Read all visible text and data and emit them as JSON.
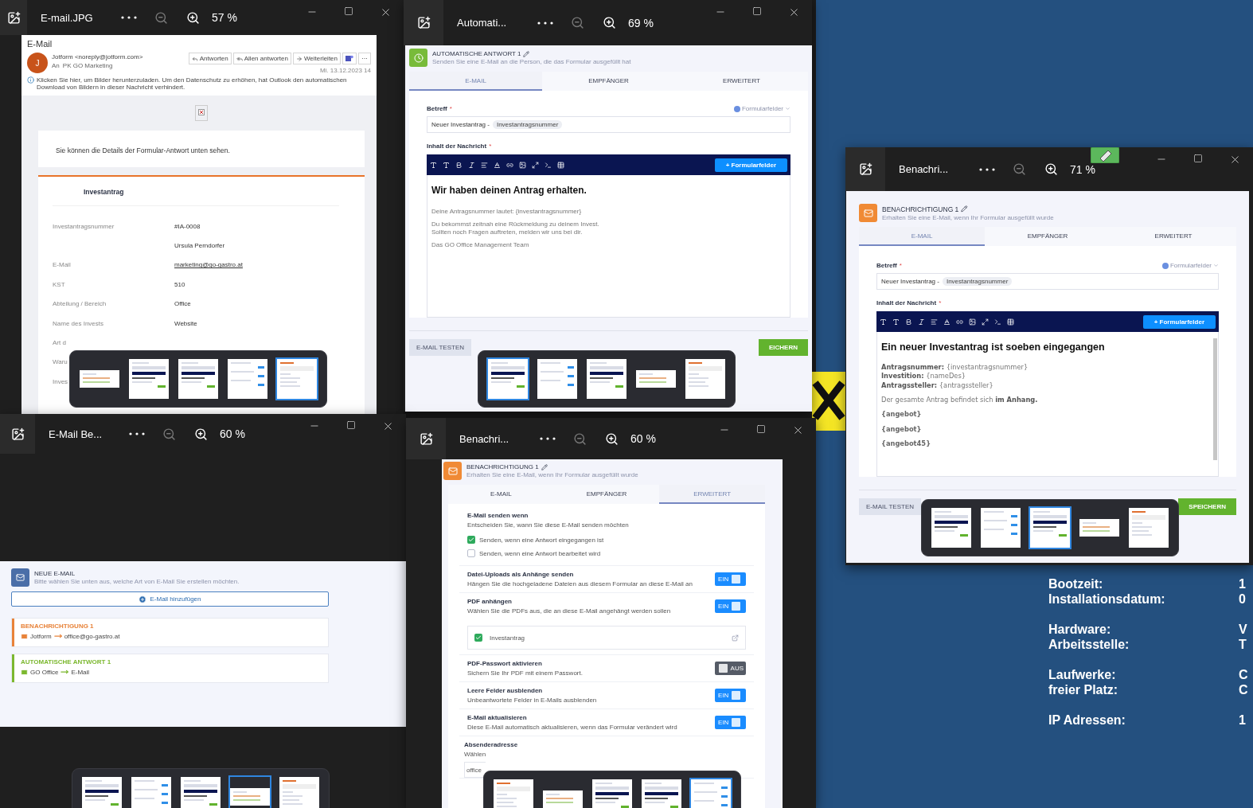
{
  "windows": [
    {
      "kind": "email",
      "title": "E-mail.JPG",
      "zoom": "57 %",
      "thumbnails": [
        {
          "kind": "list",
          "selected": false
        },
        {
          "kind": "editor",
          "selected": false
        },
        {
          "kind": "editor",
          "selected": false
        },
        {
          "kind": "settings",
          "selected": false
        },
        {
          "kind": "email",
          "selected": true
        }
      ],
      "page": {
        "heading": "E-Mail",
        "initial": "J",
        "sender": "Jotform <noreply@jotform.com>",
        "to_label": "An",
        "to": "PK GO Marketing",
        "actions": [
          "Antworten",
          "Allen antworten",
          "Weiterleiten"
        ],
        "more": "···",
        "date": "Mi. 13.12.2023 14",
        "notice": "Klicken Sie hier, um Bilder herunterzuladen. Um den Datenschutz zu erhöhen, hat Outlook den automatischen Download von Bildern in dieser Nachricht verhindert.",
        "intro": "Sie können die Details der Formular-Antwort unten sehen.",
        "form_title": "Investantrag",
        "rows": [
          {
            "kind": "text",
            "label": "Investantragsnummer",
            "value": "#IA-0008"
          },
          {
            "kind": "text",
            "value": "Ursula Perndorfer"
          },
          {
            "kind": "link",
            "label": "E-Mail",
            "value": "marketing@go-gastro.at"
          },
          {
            "kind": "text",
            "label": "KST",
            "value": "510"
          },
          {
            "kind": "text",
            "label": "Abteilung / Bereich",
            "value": "Office"
          },
          {
            "kind": "text",
            "label": "Name des Invests",
            "value": "Website"
          },
          {
            "kind": "text",
            "label": "Art d"
          },
          {
            "kind": "text",
            "label": "Waru"
          },
          {
            "kind": "text",
            "label": "Inves"
          }
        ]
      }
    },
    {
      "kind": "editor",
      "title": "Automati...",
      "zoom": "69 %",
      "thumbnails": [
        {
          "kind": "editor",
          "selected": true
        },
        {
          "kind": "settings",
          "selected": false
        },
        {
          "kind": "editor",
          "selected": false
        },
        {
          "kind": "list",
          "selected": false
        },
        {
          "kind": "email",
          "selected": false
        }
      ],
      "page": {
        "kind": "autoresponder",
        "title": "AUTOMATISCHE ANTWORT 1",
        "subtitle": "Senden Sie eine E-Mail an die Person, die das Formular ausgefüllt hat",
        "tabs": [
          {
            "label": "E-MAIL",
            "selected": true
          },
          {
            "label": "EMPFÄNGER",
            "selected": false
          },
          {
            "label": "ERWEITERT",
            "selected": false
          }
        ],
        "subject_label": "Betreff",
        "required_mark": "*",
        "fields_link": "Formularfelder",
        "subject_text": "Neuer Investantrag -",
        "subject_chip": "Investantragsnummer",
        "body_label": "Inhalt der Nachricht",
        "insert_button": "+ Formularfelder",
        "body": [
          {
            "kind": "heading",
            "lines": [
              "Wir haben deinen Antrag erhalten."
            ]
          },
          {
            "kind": "para",
            "lines": [
              "Deine Antragsnummer lautet: {investantragsnummer}"
            ]
          },
          {
            "kind": "para",
            "lines": [
              "Du bekommst zeitnah eine Rückmeldung zu deinem Invest.",
              "Sollten noch Fragen auftreten, melden wir uns bei dir."
            ]
          },
          {
            "kind": "para",
            "lines": [
              "Das GO Office Management Team"
            ]
          }
        ],
        "test_button": "E-MAIL TESTEN",
        "save_button": "EICHERN"
      }
    },
    {
      "kind": "editor",
      "title": "Benachri...",
      "zoom": "71 %",
      "thumbnails": [
        {
          "kind": "editor",
          "selected": false
        },
        {
          "kind": "settings",
          "selected": false
        },
        {
          "kind": "editor",
          "selected": true
        },
        {
          "kind": "list",
          "selected": false
        },
        {
          "kind": "email",
          "selected": false
        }
      ],
      "page": {
        "kind": "notification",
        "title": "BENACHRICHTIGUNG 1",
        "subtitle": "Erhalten Sie eine E-Mail, wenn Ihr Formular ausgefüllt wurde",
        "tabs": [
          {
            "label": "E-MAIL",
            "selected": true
          },
          {
            "label": "EMPFÄNGER",
            "selected": false
          },
          {
            "label": "ERWEITERT",
            "selected": false
          }
        ],
        "subject_label": "Betreff",
        "required_mark": "*",
        "fields_link": "Formularfelder",
        "subject_text": "Neuer Investantrag -",
        "subject_chip": "Investantragsnummer",
        "body_label": "Inhalt der Nachricht",
        "insert_button": "+ Formularfelder",
        "body": [
          {
            "kind": "heading",
            "lines": [
              "Ein neuer Investantrag ist soeben eingegangen"
            ]
          },
          {
            "kind": "para",
            "lines": [
              "**Antragsnummer:** {investantragsnummer}",
              "**Investition:** {nameDes}",
              "**Antragssteller:** {antragssteller}"
            ]
          },
          {
            "kind": "para",
            "lines": [
              "Der gesamte Antrag befindet sich **im Anhang.**"
            ]
          },
          {
            "kind": "token",
            "lines": [
              "{angebot}"
            ]
          },
          {
            "kind": "token",
            "lines": [
              "{angebot}"
            ]
          },
          {
            "kind": "token",
            "lines": [
              "{angebot45}"
            ]
          }
        ],
        "test_button": "E-MAIL TESTEN",
        "save_button": "SPEICHERN"
      }
    },
    {
      "kind": "list",
      "title": "E-Mail Be...",
      "zoom": "60 %",
      "thumbnails": [
        {
          "kind": "editor",
          "selected": false
        },
        {
          "kind": "settings",
          "selected": false
        },
        {
          "kind": "editor",
          "selected": false
        },
        {
          "kind": "list",
          "selected": true
        },
        {
          "kind": "email",
          "selected": false
        }
      ],
      "page": {
        "title": "NEUE E-MAIL",
        "subtitle": "Bitte wählen Sie unten aus, welche Art von E-Mail Sie erstellen möchten.",
        "add_button": "E-Mail hinzufügen",
        "items": [
          {
            "title": "BENACHRICHTIGUNG 1",
            "color": "#e8833a",
            "from": "Jotform",
            "to": "office@go-gastro.at"
          },
          {
            "title": "AUTOMATISCHE ANTWORT 1",
            "color": "#7cb82f",
            "from": "GO Office",
            "to": "E-Mail"
          }
        ]
      }
    },
    {
      "kind": "settings",
      "title": "Benachri...",
      "zoom": "60 %",
      "thumbnails": [
        {
          "kind": "email",
          "selected": false
        },
        {
          "kind": "list",
          "selected": false
        },
        {
          "kind": "editor",
          "selected": false
        },
        {
          "kind": "editor",
          "selected": false
        },
        {
          "kind": "settings",
          "selected": true
        }
      ],
      "page": {
        "kind": "notification",
        "title": "BENACHRICHTIGUNG 1",
        "subtitle": "Erhalten Sie eine E-Mail, wenn Ihr Formular ausgefüllt wurde",
        "tabs": [
          {
            "label": "E-MAIL",
            "selected": false
          },
          {
            "label": "EMPFÄNGER",
            "selected": false
          },
          {
            "label": "ERWEITERT",
            "selected": true
          }
        ],
        "sections": [
          {
            "kind": "checks",
            "title": "E-Mail senden wenn",
            "desc": "Entscheiden Sie, wann Sie diese E-Mail senden möchten",
            "options": [
              {
                "label": "Senden, wenn eine Antwort eingegangen ist",
                "checked": true
              },
              {
                "label": "Senden, wenn eine Antwort bearbeitet wird",
                "checked": false
              }
            ]
          },
          {
            "kind": "toggle",
            "title": "Datei-Uploads als Anhänge senden",
            "desc": "Hängen Sie die hochgeladene Dateien aus diesem Formular an diese E-Mail an",
            "on": true,
            "state": "EIN"
          },
          {
            "kind": "toggle",
            "title": "PDF anhängen",
            "desc": "Wählen Sie die PDFs aus, die an diese E-Mail angehängt werden sollen",
            "on": true,
            "state": "EIN",
            "attachments": [
              {
                "label": "Investantrag",
                "checked": true
              }
            ]
          },
          {
            "kind": "toggle",
            "title": "PDF-Passwort aktivieren",
            "desc": "Sichern Sie Ihr PDF mit einem Passwort.",
            "on": false,
            "state": "AUS"
          },
          {
            "kind": "toggle",
            "title": "Leere Felder ausblenden",
            "desc": "Unbeantwortete Felder in E-Mails ausblenden",
            "on": true,
            "state": "EIN"
          },
          {
            "kind": "toggle",
            "title": "E-Mail aktualisieren",
            "desc": "Diese E-Mail automatisch aktualisieren, wenn das Formular verändert wird",
            "on": true,
            "state": "EIN"
          },
          {
            "kind": "field",
            "title": "Absenderadresse",
            "desc": "Wählen",
            "value": "office"
          }
        ]
      }
    }
  ],
  "desktop_info": [
    [
      {
        "label": "Bootzeit:",
        "value": "1"
      },
      {
        "label": "Installationsdatum:",
        "value": "0"
      }
    ],
    [
      {
        "label": "Hardware:",
        "value": "V"
      },
      {
        "label": "Arbeitsstelle:",
        "value": "T"
      }
    ],
    [
      {
        "label": "Laufwerke:",
        "value": "C"
      },
      {
        "label": "freier Platz:",
        "value": "C"
      }
    ],
    [
      {
        "label": "IP Adressen:",
        "value": "1"
      }
    ]
  ]
}
